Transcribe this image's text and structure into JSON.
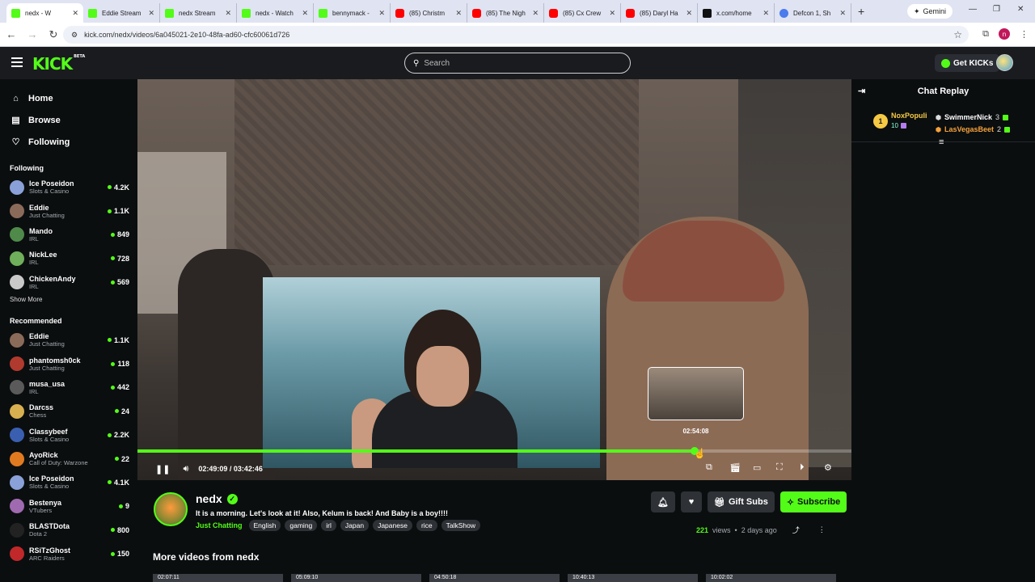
{
  "browser": {
    "tabs": [
      {
        "label": "nedx - W",
        "icon": "kick",
        "active": true
      },
      {
        "label": "Eddie Stream",
        "icon": "kick"
      },
      {
        "label": "nedx Stream",
        "icon": "kick"
      },
      {
        "label": "nedx - Watch",
        "icon": "kick"
      },
      {
        "label": "bennymack -",
        "icon": "kick"
      },
      {
        "label": "(85) Christm",
        "icon": "youtube"
      },
      {
        "label": "(85) The Nigh",
        "icon": "youtube"
      },
      {
        "label": "(85) Cx Crew",
        "icon": "youtube"
      },
      {
        "label": "(85) Daryl Ha",
        "icon": "youtube"
      },
      {
        "label": "x.com/home",
        "icon": "x"
      },
      {
        "label": "Defcon 1, Sh",
        "icon": "globe"
      }
    ],
    "gemini_label": "Gemini",
    "url": "kick.com/nedx/videos/6a045021-2e10-48fa-ad60-cfc60061d726",
    "profile_initial": "n"
  },
  "header": {
    "logo": "KICK",
    "logo_badge": "BETA",
    "search_placeholder": "Search",
    "get_kicks": "Get KICKs"
  },
  "sidebar": {
    "nav": [
      {
        "label": "Home",
        "icon": "home-icon"
      },
      {
        "label": "Browse",
        "icon": "browse-icon"
      },
      {
        "label": "Following",
        "icon": "heart-icon"
      }
    ],
    "following_title": "Following",
    "following": [
      {
        "name": "Ice Poseidon",
        "category": "Slots & Casino",
        "viewers": "4.2K",
        "color": "#8aa0d8"
      },
      {
        "name": "Eddie",
        "category": "Just Chatting",
        "viewers": "1.1K",
        "color": "#8a6b5a"
      },
      {
        "name": "Mando",
        "category": "IRL",
        "viewers": "849",
        "color": "#4f8a4a"
      },
      {
        "name": "NickLee",
        "category": "IRL",
        "viewers": "728",
        "color": "#6fae5a"
      },
      {
        "name": "ChickenAndy",
        "category": "IRL",
        "viewers": "569",
        "color": "#c9c9c9"
      }
    ],
    "show_more": "Show More",
    "recommended_title": "Recommended",
    "recommended": [
      {
        "name": "Eddie",
        "category": "Just Chatting",
        "viewers": "1.1K",
        "color": "#8a6b5a"
      },
      {
        "name": "phantomsh0ck",
        "category": "Just Chatting",
        "viewers": "118",
        "color": "#b03a2e"
      },
      {
        "name": "musa_usa",
        "category": "IRL",
        "viewers": "442",
        "color": "#5a5a5a"
      },
      {
        "name": "Darcss",
        "category": "Chess",
        "viewers": "24",
        "color": "#d8b050"
      },
      {
        "name": "Classybeef",
        "category": "Slots & Casino",
        "viewers": "2.2K",
        "color": "#3a5fb0"
      },
      {
        "name": "AyoRick",
        "category": "Call of Duty: Warzone",
        "viewers": "22",
        "color": "#e07a20"
      },
      {
        "name": "Ice Poseidon",
        "category": "Slots & Casino",
        "viewers": "4.1K",
        "color": "#8aa0d8"
      },
      {
        "name": "Bestenya",
        "category": "VTubers",
        "viewers": "9",
        "color": "#a06ab0"
      },
      {
        "name": "BLASTDota",
        "category": "Dota 2",
        "viewers": "800",
        "color": "#222222"
      },
      {
        "name": "RSiTzGhost",
        "category": "ARC Raiders",
        "viewers": "150",
        "color": "#c0282a"
      }
    ]
  },
  "player": {
    "current_time": "02:49:09",
    "duration": "03:42:46",
    "time_display": "02:49:09 / 03:42:46",
    "progress_fraction": 0.7583,
    "hover_time": "02:54:08",
    "hover_fraction": 0.7805
  },
  "chat": {
    "title": "Chat Replay",
    "top_gifters": [
      {
        "rank": "1",
        "name": "NoxPopuli",
        "count": "10"
      },
      {
        "name": "SwimmerNick",
        "count": "3",
        "color": "#ffffff"
      },
      {
        "name": "LasVegasBeet",
        "count": "2",
        "color": "#f6a23c"
      }
    ]
  },
  "video_info": {
    "channel": "nedx",
    "title": "It is a morning. Let's look at it! Also, Kelum is back! And Baby is a boy!!!!",
    "category": "Just Chatting",
    "tags": [
      "English",
      "gaming",
      "irl",
      "Japan",
      "Japanese",
      "rice",
      "TalkShow"
    ],
    "gift_subs": "Gift Subs",
    "subscribe": "Subscribe",
    "views": "221",
    "views_label": "views",
    "separator": "•",
    "age": "2 days ago",
    "more_videos_title": "More videos from nedx",
    "more_videos": [
      {
        "duration": "02:07:11"
      },
      {
        "duration": "05:09:10"
      },
      {
        "duration": "04:50:18"
      },
      {
        "duration": "10:40:13"
      },
      {
        "duration": "10:02:02"
      }
    ]
  }
}
